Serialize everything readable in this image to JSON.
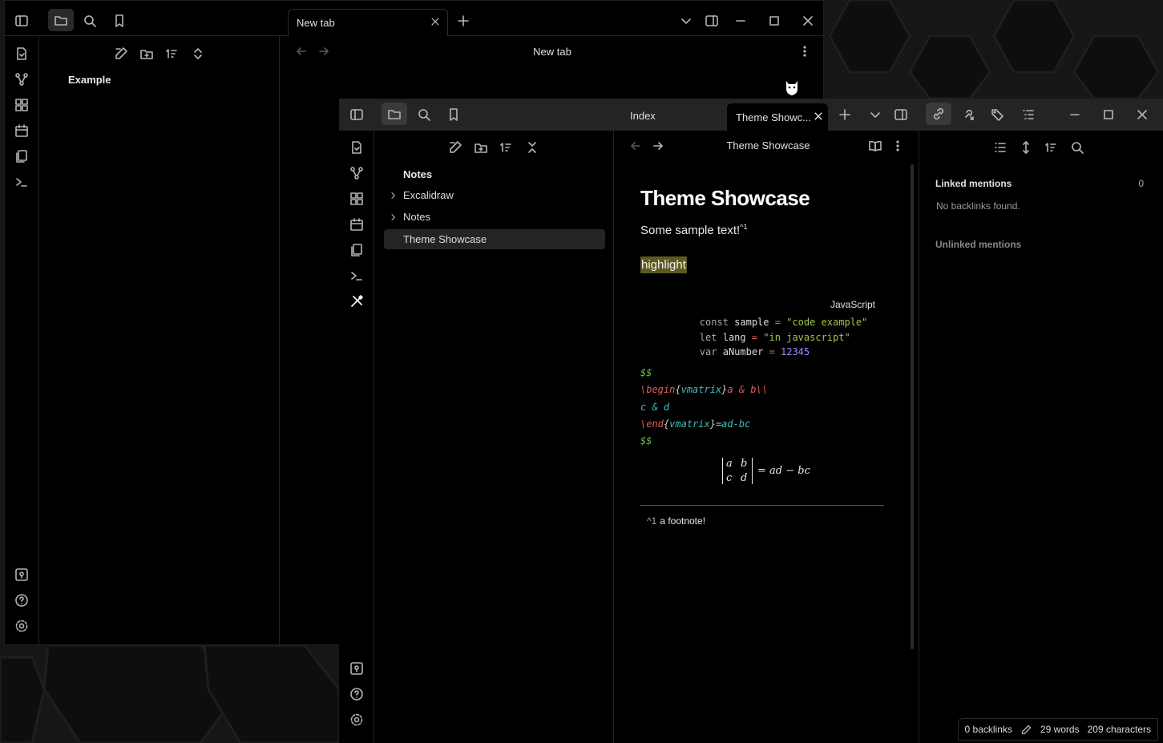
{
  "back_window": {
    "sidebar": {
      "vault_item": "Example"
    },
    "tab": {
      "title": "New tab"
    },
    "view_title": "New tab"
  },
  "front_window": {
    "left_title": "Index",
    "tab": {
      "title": "Theme Showc..."
    },
    "file_tree": {
      "root": "Notes",
      "items": [
        {
          "label": "Excalidraw",
          "folder": true
        },
        {
          "label": "Notes",
          "folder": true
        },
        {
          "label": "Theme Showcase",
          "folder": false,
          "active": true
        }
      ]
    },
    "view_header": {
      "title": "Theme Showcase"
    },
    "note": {
      "heading": "Theme Showcase",
      "paragraph": "Some sample text!",
      "footnote_ref": "^1",
      "highlight": "highlight",
      "code_lang": "JavaScript",
      "code_lines": [
        {
          "kw": "const",
          "name": "sample",
          "op": "=",
          "val": "\"code example\"",
          "type": "str"
        },
        {
          "kw": "let",
          "name": "lang",
          "op": "=",
          "val": "\"in javascript\"",
          "type": "str"
        },
        {
          "kw": "var",
          "name": "aNumber",
          "op": "=",
          "val": "12345",
          "type": "num"
        }
      ],
      "math_source": [
        "$$",
        "\\begin{vmatrix}a & b\\\\",
        "c & d",
        "\\end{vmatrix}=ad-bc",
        "$$"
      ],
      "math_render": {
        "a": "a",
        "b": "b",
        "c": "c",
        "d": "d",
        "rhs": "= ad − bc"
      },
      "footnote": {
        "ref": "^1",
        "text": "a footnote!"
      }
    },
    "backlinks": {
      "linked_title": "Linked mentions",
      "linked_count": "0",
      "empty_text": "No backlinks found.",
      "unlinked_title": "Unlinked mentions"
    },
    "status": {
      "backlinks": "0 backlinks",
      "words": "29 words",
      "chars": "209 characters"
    }
  },
  "colors": {
    "accent": "#3fbf9f",
    "highlight_bg": "#5c5a1e",
    "code_string": "#a3c44e",
    "code_number": "#9b8cff",
    "math_red": "#e05c5c",
    "math_cyan": "#3fbfbf",
    "math_green": "#6fbf4e"
  }
}
